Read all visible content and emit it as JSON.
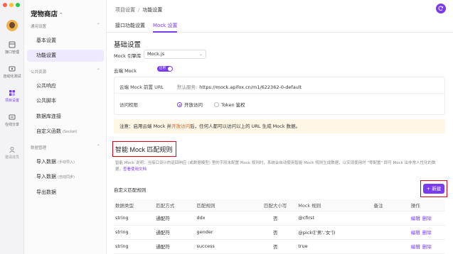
{
  "rail": {
    "items": [
      {
        "label": "接口管理",
        "icon": "api-icon"
      },
      {
        "label": "自动化测试",
        "icon": "test-icon"
      },
      {
        "label": "项目设置",
        "icon": "settings-icon",
        "active": true
      },
      {
        "label": "在线分享",
        "icon": "share-icon"
      },
      {
        "label": "邀请成员",
        "icon": "invite-icon"
      }
    ]
  },
  "sidebar": {
    "project_name": "宠物商店",
    "groups": [
      {
        "title": "通用设置",
        "items": [
          {
            "label": "基本设置"
          },
          {
            "label": "功能设置",
            "active": true
          }
        ]
      },
      {
        "title": "公共资源",
        "items": [
          {
            "label": "公共响应"
          },
          {
            "label": "公共脚本"
          },
          {
            "label": "数据库连接"
          },
          {
            "label": "自定义函数",
            "sub": "(Socket)"
          }
        ]
      },
      {
        "title": "数据管理",
        "items": [
          {
            "label": "导入数据",
            "sub": "(手动导入)"
          },
          {
            "label": "导入数据",
            "sub": "(自动同步)"
          },
          {
            "label": "导出数据"
          }
        ]
      }
    ]
  },
  "header": {
    "breadcrumb": [
      "项目设置",
      "功能设置"
    ]
  },
  "tabs": [
    {
      "label": "接口功能设置"
    },
    {
      "label": "Mock 设置",
      "active": true
    }
  ],
  "basic": {
    "title": "基础设置",
    "engine_label": "Mock 引擎库",
    "engine_value": "Mock.js",
    "cloud_label": "云端 Mock",
    "cloud_toggle": "启用",
    "cloud_url_label": "云端 Mock 前置 URL",
    "cloud_url_prefix": "默认服务:",
    "cloud_url": "https://mock.apifox.cn/m1/622362-0-default",
    "access_label": "访问权限",
    "access_options": [
      {
        "label": "开放访问",
        "selected": true
      },
      {
        "label": "Token 鉴权",
        "selected": false
      }
    ],
    "warning_pre": "注意：启用云端 Mock 并",
    "warning_highlight": "开放访问",
    "warning_post": "后，任何人都可以访问以上的 URL 生成 Mock 数据。"
  },
  "smart": {
    "title": "智能 Mock 匹配规则",
    "desc": "智能 Mock 说明：当接口设计的返回响应 (或数据模型) 里的字段未配置 Mock 规则时，系统会自动使用智能 Mock 规则生成数据，以实现使用时 \"零配置\" 即可 Mock 出非常人性化的数据。",
    "doc_link": "查看使用文档",
    "rules_label": "自定义匹配规则",
    "new_button": "+ 新建",
    "columns": [
      "数据类型",
      "匹配方式",
      "匹配规则",
      "匹配大小写",
      "Mock 规则",
      "备注",
      "操作"
    ],
    "rows": [
      {
        "type": "string",
        "mode": "通配符",
        "rule": "ddx",
        "case": "否",
        "mock": "@cfirst",
        "note": "",
        "edit": "编辑",
        "del": "删除"
      },
      {
        "type": "string",
        "mode": "通配符",
        "rule": "gender",
        "case": "否",
        "mock": "@pick(['男','女'])",
        "note": "",
        "edit": "编辑",
        "del": "删除"
      },
      {
        "type": "string",
        "mode": "通配符",
        "rule": "success",
        "case": "否",
        "mock": "true",
        "note": "",
        "edit": "编辑",
        "del": "删除"
      }
    ]
  },
  "colors": {
    "accent": "#7a3cf0",
    "highlight_box": "#e0001a",
    "warning_bg": "#fff6e5",
    "warning_text": "#e8632b"
  }
}
